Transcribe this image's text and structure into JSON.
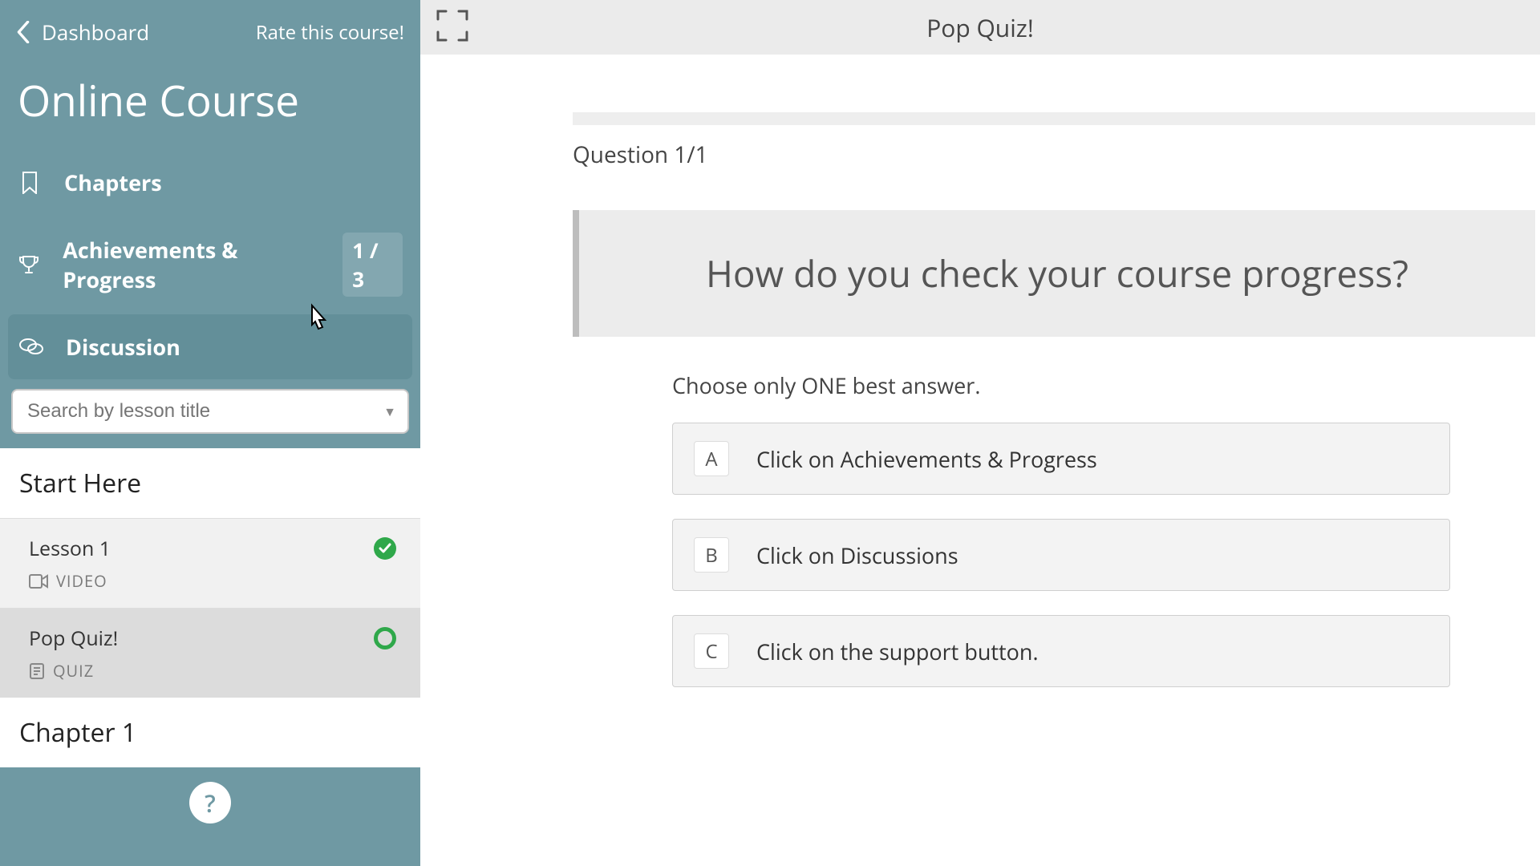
{
  "sidebar": {
    "dashboard_label": "Dashboard",
    "rate_label": "Rate this course!",
    "course_title": "Online Course",
    "nav": {
      "chapters": {
        "label": "Chapters"
      },
      "achievements": {
        "label": "Achievements & Progress",
        "badge": "1 / 3"
      },
      "discussion": {
        "label": "Discussion"
      }
    },
    "search_placeholder": "Search by lesson title",
    "sections": [
      {
        "title": "Start Here",
        "lessons": [
          {
            "name": "Lesson 1",
            "type": "VIDEO",
            "status": "done"
          },
          {
            "name": "Pop Quiz!",
            "type": "QUIZ",
            "status": "progress"
          }
        ]
      },
      {
        "title": "Chapter 1",
        "lessons": []
      }
    ],
    "help_glyph": "?"
  },
  "main": {
    "title": "Pop Quiz!",
    "question_counter": "Question 1/1",
    "question": "How do you check your course progress?",
    "instruction": "Choose only ONE best answer.",
    "answers": [
      {
        "letter": "A",
        "text": "Click on Achievements & Progress"
      },
      {
        "letter": "B",
        "text": "Click on Discussions"
      },
      {
        "letter": "C",
        "text": "Click on the support button."
      }
    ]
  }
}
